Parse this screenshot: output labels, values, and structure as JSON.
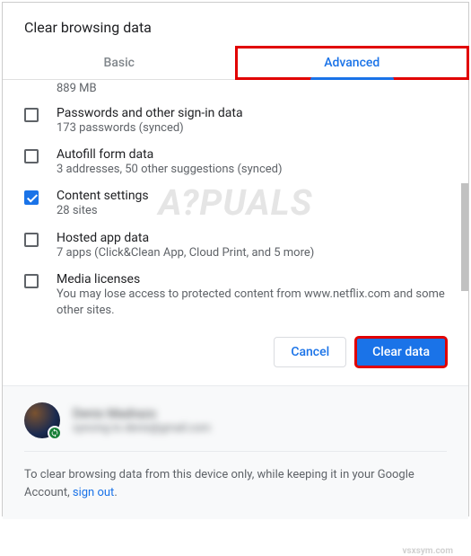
{
  "dialog": {
    "title": "Clear browsing data",
    "tabs": {
      "basic": "Basic",
      "advanced": "Advanced"
    },
    "partial_top": "889 MB",
    "items": [
      {
        "label": "Passwords and other sign-in data",
        "sub": "173 passwords (synced)",
        "checked": false
      },
      {
        "label": "Autofill form data",
        "sub": "3 addresses, 50 other suggestions (synced)",
        "checked": false
      },
      {
        "label": "Content settings",
        "sub": "28 sites",
        "checked": true
      },
      {
        "label": "Hosted app data",
        "sub": "7 apps (Click&Clean App, Cloud Print, and 5 more)",
        "checked": false
      },
      {
        "label": "Media licenses",
        "sub": "You may lose access to protected content from www.netflix.com and some other sites.",
        "checked": false
      }
    ],
    "buttons": {
      "cancel": "Cancel",
      "clear": "Clear data"
    }
  },
  "profile": {
    "name": "Denis Madrazo",
    "email": "syncing to denis@gmail.com"
  },
  "footer": {
    "text_before": "To clear browsing data from this device only, while keeping it in your Google Account, ",
    "link": "sign out",
    "text_after": "."
  },
  "watermark": {
    "main": "A?PUALS",
    "site": "vsxsym.com"
  }
}
